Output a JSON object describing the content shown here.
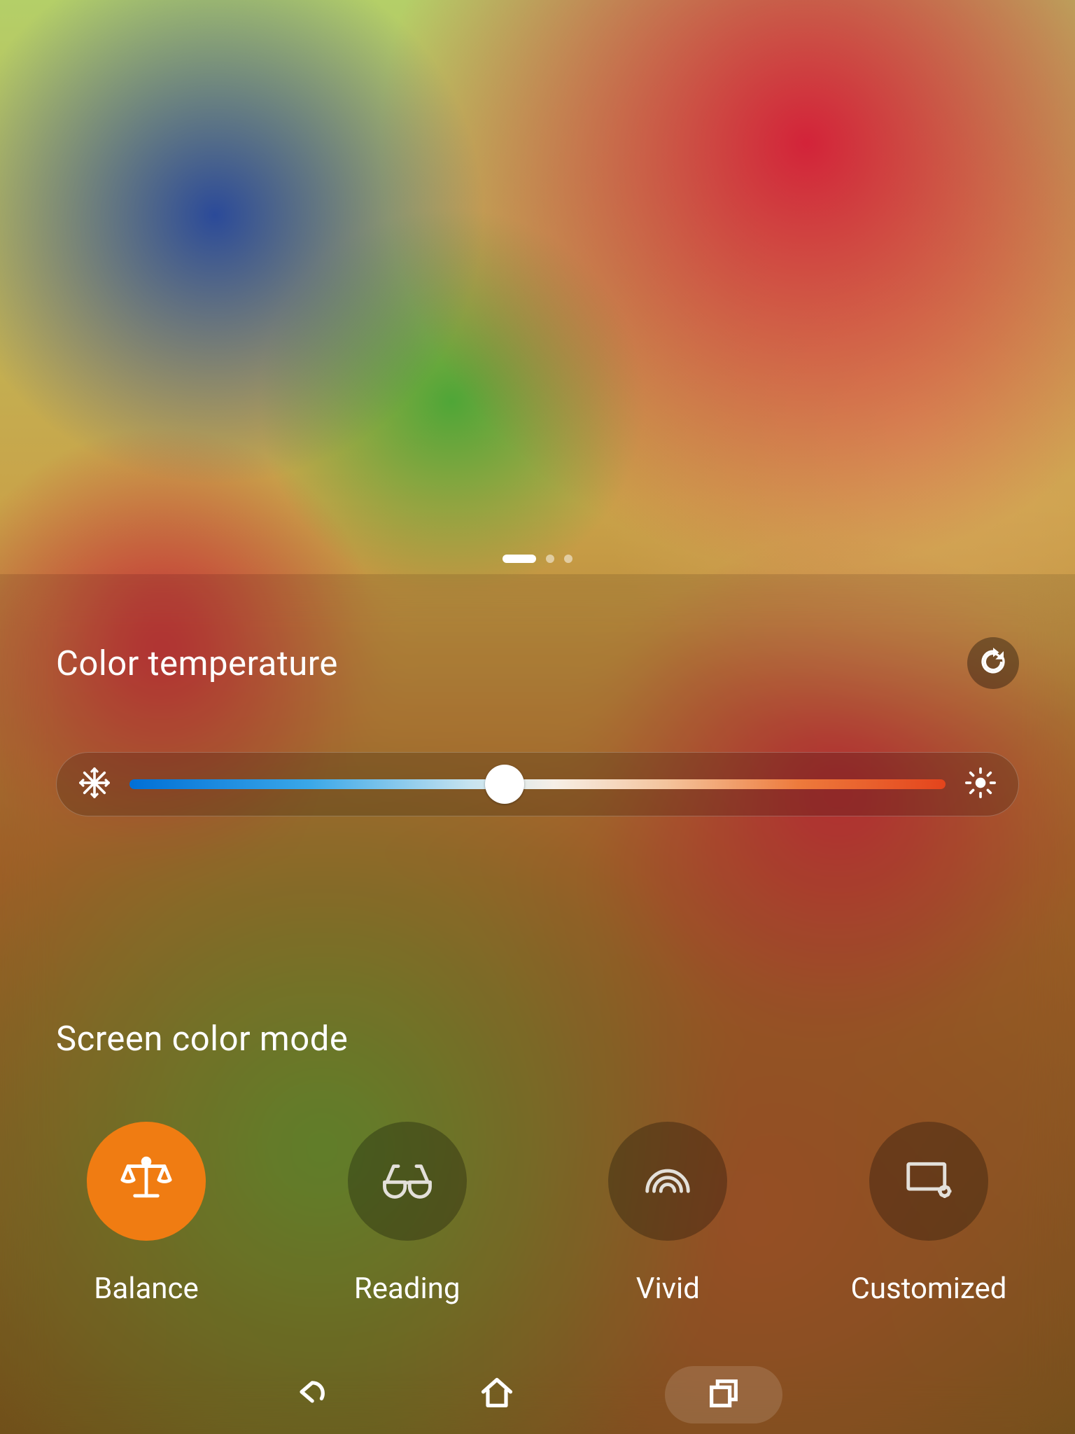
{
  "carousel": {
    "count": 3,
    "active_index": 0
  },
  "color_temperature": {
    "title": "Color temperature",
    "slider_percent": 46
  },
  "screen_mode": {
    "title": "Screen color mode",
    "selected_index": 0,
    "options": [
      {
        "label": "Balance"
      },
      {
        "label": "Reading"
      },
      {
        "label": "Vivid"
      },
      {
        "label": "Customized"
      }
    ]
  }
}
